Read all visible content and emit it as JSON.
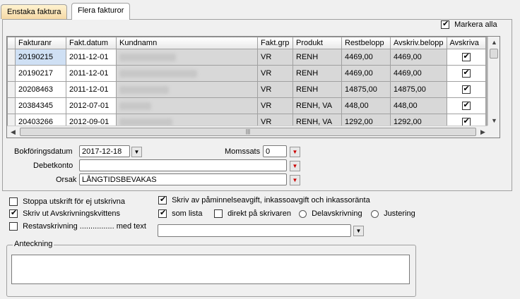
{
  "tabs": [
    {
      "label": "Enstaka faktura",
      "active": false
    },
    {
      "label": "Flera fakturor",
      "active": true
    }
  ],
  "select_all": {
    "label": "Markera alla",
    "checked": true
  },
  "table": {
    "columns": [
      "Fakturanr",
      "Fakt.datum",
      "Kundnamn",
      "Fakt.grp",
      "Produkt",
      "Restbelopp",
      "Avskriv.belopp",
      "Avskriva"
    ],
    "rows": [
      {
        "fakturanr": "20190215",
        "datum": "2011-12-01",
        "grp": "VR",
        "produkt": "RENH",
        "rest": "4469,00",
        "avskriv": "4469,00",
        "checked": true
      },
      {
        "fakturanr": "20190217",
        "datum": "2011-12-01",
        "grp": "VR",
        "produkt": "RENH",
        "rest": "4469,00",
        "avskriv": "4469,00",
        "checked": true
      },
      {
        "fakturanr": "20208463",
        "datum": "2011-12-01",
        "grp": "VR",
        "produkt": "RENH",
        "rest": "14875,00",
        "avskriv": "14875,00",
        "checked": true
      },
      {
        "fakturanr": "20384345",
        "datum": "2012-07-01",
        "grp": "VR",
        "produkt": "RENH, VA",
        "rest": "448,00",
        "avskriv": "448,00",
        "checked": true
      },
      {
        "fakturanr": "20403266",
        "datum": "2012-09-01",
        "grp": "VR",
        "produkt": "RENH, VA",
        "rest": "1292,00",
        "avskriv": "1292,00",
        "checked": true
      }
    ]
  },
  "form": {
    "bokforingsdatum_label": "Bokföringsdatum",
    "bokforingsdatum_value": "2017-12-18",
    "momssats_label": "Momssats",
    "momssats_value": "0",
    "debetkonto_label": "Debetkonto",
    "debetkonto_value": "",
    "orsak_label": "Orsak",
    "orsak_value": "LÅNGTIDSBEVAKAS"
  },
  "options": {
    "stoppa": {
      "label": "Stoppa utskrift för ej utskrivna",
      "checked": false
    },
    "skriv_ut": {
      "label": "Skriv ut Avskrivningskvittens",
      "checked": true
    },
    "restavskrivning": {
      "label": "Restavskrivning ................ med text",
      "checked": false
    },
    "skriv_av": {
      "label": "Skriv av påminnelseavgift, inkassoavgift och inkassoränta",
      "checked": true
    },
    "som_lista": {
      "label": "som lista",
      "checked": true
    },
    "direkt": {
      "label": "direkt på skrivaren",
      "checked": false
    },
    "delavskrivning": {
      "label": "Delavskrivning",
      "selected": false
    },
    "justering": {
      "label": "Justering",
      "selected": false
    },
    "text_value": ""
  },
  "anteckning": {
    "label": "Anteckning",
    "value": ""
  }
}
